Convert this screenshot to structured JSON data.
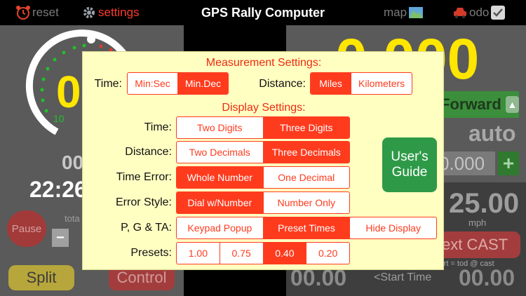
{
  "topbar": {
    "reset_label": "reset",
    "settings_label": "settings",
    "title": "GPS Rally Computer",
    "map_label": "map",
    "odo_label": "odo"
  },
  "background": {
    "left": {
      "dial_value": "0",
      "dial_tick": "10",
      "time_small": "00",
      "time_large": "22:26",
      "pause_label": "Pause",
      "total_label": "tota",
      "minus_label": "−",
      "split_label": "Split",
      "control_label": "Control"
    },
    "right": {
      "distance_value": "0.000",
      "forward_label": "Forward",
      "auto_label": "auto",
      "cast_value": "0.000",
      "plus_label": "+",
      "speed_value": "25.00",
      "mph_label": "mph",
      "next_cast_label": "ext CAST",
      "start_eq_label": "start = tod @ cast",
      "bottom_left_value": "00.00",
      "start_time_label": "<Start Time",
      "bottom_right_value": "00.00"
    }
  },
  "settings": {
    "measurement_title": "Measurement Settings:",
    "time_label": "Time:",
    "time_options": [
      "Min:Sec",
      "Min.Dec"
    ],
    "time_selected": 1,
    "distance_label": "Distance:",
    "distance_options": [
      "Miles",
      "Kilometers"
    ],
    "distance_selected": 0,
    "display_title": "Display Settings:",
    "rows": [
      {
        "label": "Time:",
        "options": [
          "Two Digits",
          "Three Digits"
        ],
        "selected": 1
      },
      {
        "label": "Distance:",
        "options": [
          "Two Decimals",
          "Three Decimals"
        ],
        "selected": 1
      },
      {
        "label": "Time Error:",
        "options": [
          "Whole Number",
          "One Decimal"
        ],
        "selected": 0
      },
      {
        "label": "Error Style:",
        "options": [
          "Dial w/Number",
          "Number Only"
        ],
        "selected": 0
      },
      {
        "label": "P, G & TA:",
        "options": [
          "Keypad Popup",
          "Preset Times",
          "Hide Display"
        ],
        "selected": 1
      },
      {
        "label": "Presets:",
        "options": [
          "1.00",
          "0.75",
          "0.40",
          "0.20"
        ],
        "selected": 2
      }
    ],
    "guide_label_line1": "User's",
    "guide_label_line2": "Guide"
  },
  "colors": {
    "accent": "#ff3b1e",
    "popup_bg": "#ffffc2",
    "guide_green": "#2e9a48",
    "yellow_digits": "#ffe600"
  }
}
